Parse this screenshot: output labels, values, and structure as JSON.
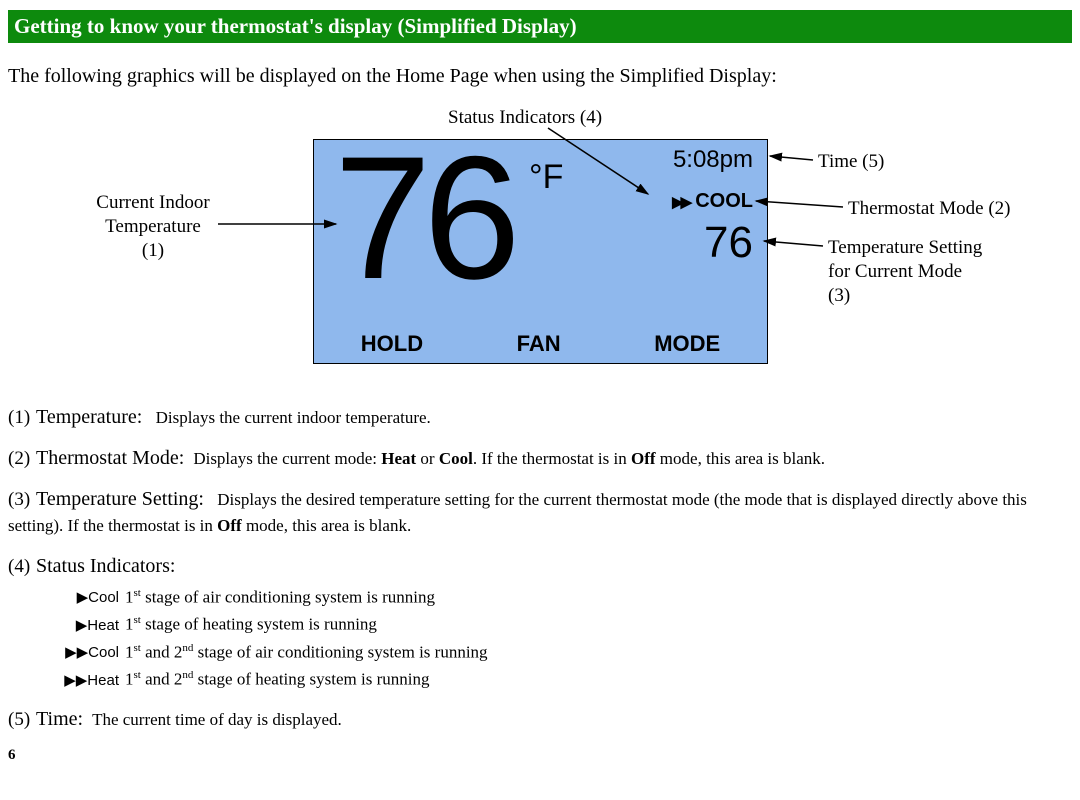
{
  "banner": "Getting to know your thermostat's display (Simplified Display)",
  "intro": "The following graphics will be displayed on the Home Page when using the Simplified Display:",
  "screen": {
    "big_temp": "76",
    "unit": "°F",
    "time": "5:08pm",
    "mode_arrows": "▶▶",
    "mode_text": "COOL",
    "setpoint": "76",
    "btn_hold": "HOLD",
    "btn_fan": "FAN",
    "btn_mode": "MODE"
  },
  "callouts": {
    "status": "Status Indicators (4)",
    "time": "Time (5)",
    "mode": "Thermostat Mode (2)",
    "setting_l1": "Temperature Setting",
    "setting_l2": "for Current Mode",
    "setting_l3": "(3)",
    "cur_l1": "Current Indoor",
    "cur_l2": "Temperature",
    "cur_l3": "(1)"
  },
  "items": {
    "i1_lead": "Temperature:",
    "i1_body": "Displays the current indoor temperature.",
    "i2_lead": "Thermostat Mode:",
    "i2_a": "Displays the current mode: ",
    "i2_b": "Heat",
    "i2_c": " or ",
    "i2_d": "Cool",
    "i2_e": ".  If the thermostat is in ",
    "i2_f": "Off",
    "i2_g": " mode, this area is blank.",
    "i3_lead": "Temperature Setting:",
    "i3_a": "Displays the desired temperature setting for the current thermostat mode (the mode that is displayed directly above this setting).  If the thermostat is in ",
    "i3_b": "Off",
    "i3_c": " mode, this area is blank.",
    "i4_lead": "Status Indicators:",
    "i5_lead": "Time:",
    "i5_body": "The current time of day is displayed."
  },
  "sub": {
    "r1_sym": "▶Cool",
    "r1_a": "1",
    "r1_b": " stage of air conditioning system is running",
    "r2_sym": "▶Heat",
    "r2_a": "1",
    "r2_b": " stage of heating system is running",
    "r3_sym": "▶▶Cool",
    "r3_a": "1",
    "r3_b": " and 2",
    "r3_c": " stage of air conditioning system is running",
    "r4_sym": "▶▶Heat",
    "r4_a": "1",
    "r4_b": " and 2",
    "r4_c": " stage of heating system is running"
  },
  "page": "6"
}
